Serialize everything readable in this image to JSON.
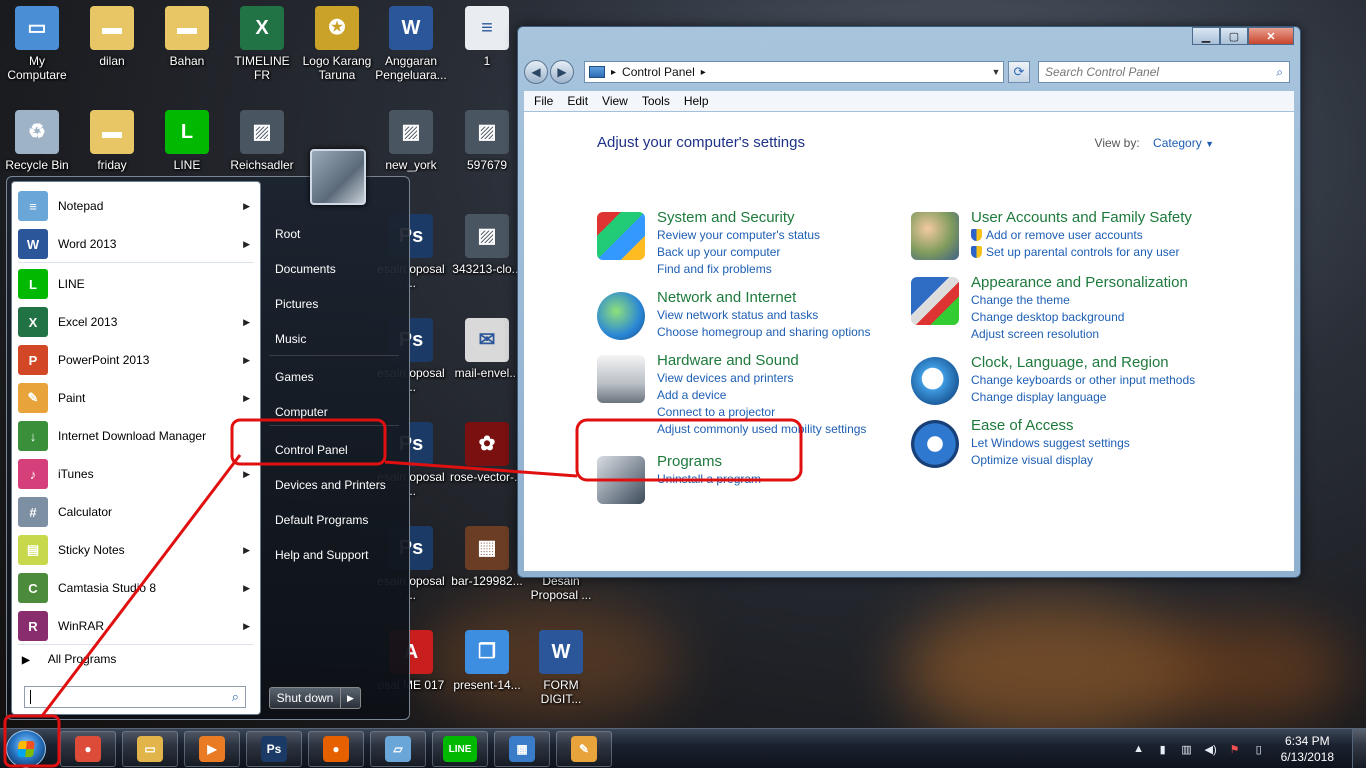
{
  "desktop": {
    "icons": [
      {
        "label": "My Computare",
        "icon": "computer-icon"
      },
      {
        "label": "dilan",
        "icon": "folder-icon"
      },
      {
        "label": "Bahan",
        "icon": "folder-icon"
      },
      {
        "label": "TIMELINE FR",
        "icon": "excel-icon"
      },
      {
        "label": "Logo Karang Taruna",
        "icon": "emblem-icon"
      },
      {
        "label": "Anggaran Pengeluara...",
        "icon": "word-icon"
      },
      {
        "label": "1",
        "icon": "document-icon"
      },
      {
        "label": "Recycle Bin",
        "icon": "recycle-bin-icon"
      },
      {
        "label": "friday",
        "icon": "folder-icon"
      },
      {
        "label": "LINE",
        "icon": "line-icon"
      },
      {
        "label": "Reichsadler",
        "icon": "image-icon"
      },
      {
        "label": "new_york",
        "icon": "image-icon"
      },
      {
        "label": "597679",
        "icon": "image-icon"
      },
      {
        "label": "esain oposal ...",
        "icon": "photoshop-icon"
      },
      {
        "label": "343213-clo...",
        "icon": "image-icon"
      },
      {
        "label": "mail-envel...",
        "icon": "mail-icon"
      },
      {
        "label": "rose-vector-...",
        "icon": "rose-icon"
      },
      {
        "label": "bar-129982...",
        "icon": "chocolate-icon"
      },
      {
        "label": "Desain Proposal ...",
        "icon": "document-icon"
      },
      {
        "label": "present-14...",
        "icon": "gift-icon"
      },
      {
        "label": "FORM DIGIT...",
        "icon": "word-icon"
      },
      {
        "label": "osal ME 017",
        "icon": "pdf-icon"
      },
      {
        "label": "esain oposal ...",
        "icon": "photoshop-icon"
      },
      {
        "label": "esain oposal ...",
        "icon": "photoshop-icon"
      },
      {
        "label": "esain oposal ...",
        "icon": "photoshop-icon"
      },
      {
        "label": "esain oposal ...",
        "icon": "photoshop-icon"
      },
      {
        "label": "esain oposal ...",
        "icon": "photoshop-icon"
      }
    ]
  },
  "control_panel": {
    "address": "Control Panel",
    "address_arrow": "▸",
    "search_placeholder": "Search Control Panel",
    "menu": [
      "File",
      "Edit",
      "View",
      "Tools",
      "Help"
    ],
    "heading": "Adjust your computer's settings",
    "view_by_label": "View by:",
    "view_by_value": "Category",
    "categories": [
      {
        "title": "System and Security",
        "icon": "shield-icon",
        "links": [
          "Review your computer's status",
          "Back up your computer",
          "Find and fix problems"
        ]
      },
      {
        "title": "Network and Internet",
        "icon": "network-globe-icon",
        "links": [
          "View network status and tasks",
          "Choose homegroup and sharing options"
        ]
      },
      {
        "title": "Hardware and Sound",
        "icon": "printer-icon",
        "links": [
          "View devices and printers",
          "Add a device",
          "Connect to a projector",
          "Adjust commonly used mobility settings"
        ]
      },
      {
        "title": "Programs",
        "icon": "programs-icon",
        "links": [
          "Uninstall a program"
        ]
      },
      {
        "title": "User Accounts and Family Safety",
        "icon": "users-icon",
        "links": [
          "Add or remove user accounts",
          "Set up parental controls for any user"
        ]
      },
      {
        "title": "Appearance and Personalization",
        "icon": "monitor-paint-icon",
        "links": [
          "Change the theme",
          "Change desktop background",
          "Adjust screen resolution"
        ]
      },
      {
        "title": "Clock, Language, and Region",
        "icon": "clock-globe-icon",
        "links": [
          "Change keyboards or other input methods",
          "Change display language"
        ]
      },
      {
        "title": "Ease of Access",
        "icon": "ease-of-access-icon",
        "links": [
          "Let Windows suggest settings",
          "Optimize visual display"
        ]
      }
    ]
  },
  "start_menu": {
    "programs": [
      {
        "label": "Notepad",
        "icon": "notepad-icon",
        "color": "#6aa6d8",
        "glyph": "≡"
      },
      {
        "label": "Word 2013",
        "icon": "word-icon",
        "color": "#2b579a",
        "glyph": "W"
      },
      {
        "label": "LINE",
        "icon": "line-icon",
        "color": "#00b900",
        "glyph": "L"
      },
      {
        "label": "Excel 2013",
        "icon": "excel-icon",
        "color": "#217346",
        "glyph": "X"
      },
      {
        "label": "PowerPoint 2013",
        "icon": "powerpoint-icon",
        "color": "#d24726",
        "glyph": "P"
      },
      {
        "label": "Paint",
        "icon": "paint-icon",
        "color": "#e8a33a",
        "glyph": "✎"
      },
      {
        "label": "Internet Download Manager",
        "icon": "idm-icon",
        "color": "#3a8f3a",
        "glyph": "↓"
      },
      {
        "label": "iTunes",
        "icon": "itunes-icon",
        "color": "#d6407a",
        "glyph": "♪"
      },
      {
        "label": "Calculator",
        "icon": "calculator-icon",
        "color": "#7d8fa3",
        "glyph": "#"
      },
      {
        "label": "Sticky Notes",
        "icon": "sticky-notes-icon",
        "color": "#c7d94a",
        "glyph": "▤"
      },
      {
        "label": "Camtasia Studio 8",
        "icon": "camtasia-icon",
        "color": "#4b8b3b",
        "glyph": "C"
      },
      {
        "label": "WinRAR",
        "icon": "winrar-icon",
        "color": "#8a2d6e",
        "glyph": "R"
      }
    ],
    "all_programs": "All Programs",
    "right_items": [
      "Root",
      "Documents",
      "Pictures",
      "Music",
      "Games",
      "Computer",
      "Control Panel",
      "Devices and Printers",
      "Default Programs",
      "Help and Support"
    ],
    "shutdown": "Shut down"
  },
  "taskbar": {
    "apps": [
      {
        "name": "chrome",
        "color": "#dd4b39",
        "glyph": "●"
      },
      {
        "name": "file-explorer",
        "color": "#e2b54a",
        "glyph": "▭"
      },
      {
        "name": "media-player",
        "color": "#e87b24",
        "glyph": "▶"
      },
      {
        "name": "photoshop",
        "color": "#1b3a66",
        "glyph": "Ps"
      },
      {
        "name": "firefox",
        "color": "#e66000",
        "glyph": "●"
      },
      {
        "name": "notepad",
        "color": "#6aa6d8",
        "glyph": "▱"
      },
      {
        "name": "line",
        "color": "#00b900",
        "glyph": "LINE"
      },
      {
        "name": "control-panel",
        "color": "#3a7cc8",
        "glyph": "▦"
      },
      {
        "name": "paint",
        "color": "#e8a33a",
        "glyph": "✎"
      }
    ],
    "time": "6:34 PM",
    "date": "6/13/2018"
  }
}
